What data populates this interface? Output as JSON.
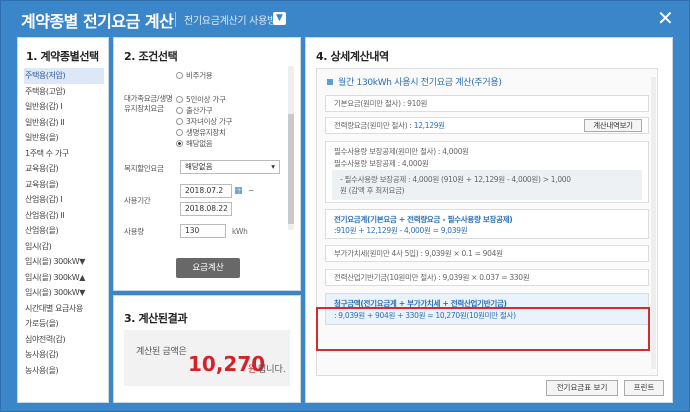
{
  "titlebar": {
    "title": "계약종별 전기요금 계산",
    "howto": "전기요금계산기 사용방법"
  },
  "panel1": {
    "title": "1. 계약종별선택",
    "items": [
      "주택용(저압)",
      "주택용(고압)",
      "일반용(갑) I",
      "일반용(갑) II",
      "일반용(을)",
      "1주택 수 가구",
      "교육용(갑)",
      "교육용(을)",
      "산업용(갑) I",
      "산업용(갑) II",
      "산업용(을)",
      "임시(갑)",
      "임시(을) 300kW▼",
      "임시(을) 300kW▲",
      "임시(을) 300kW▼",
      "시간대별 요금사용",
      "가로등(을)",
      "심야전력(갑)",
      "농사용(갑)",
      "농사용(을)"
    ]
  },
  "panel2": {
    "title": "2. 조건선택",
    "top_radio": "비주거용",
    "discount_label": "대가족요금/생명유지장치요금",
    "discount_options": [
      "5인이상 가구",
      "출산가구",
      "3자녀이상 가구",
      "생명유지장치",
      "해당없음"
    ],
    "welfare_label": "복지할인요금",
    "welfare_value": "해당없음",
    "period_label": "사용기간",
    "date_from": "2018.07.2",
    "date_to": "2018.08.22",
    "usage_label": "사용량",
    "usage_value": "130",
    "usage_unit": "kWh",
    "calc_button": "요금계산"
  },
  "panel3": {
    "title": "3. 계산된결과",
    "label": "계산된 금액은",
    "value": "10,270",
    "won": "원",
    "unit": "입니다."
  },
  "panel4": {
    "title": "4. 상세계산내역",
    "head": "월간 130kWh 사용시 전기요금 계산(주거용)",
    "base_fee": "기본요금(원미만 절사) : 910원",
    "energy_fee_label": "전력량요금(원미만 절사) : ",
    "energy_fee_value": "12,129원",
    "detail_btn": "계산내역보기",
    "guarantee1": "필수사용량 보장공제(원미만 절사) : 4,000원",
    "guarantee2": "필수사용량 보장공제 : 4,000원",
    "guarantee_note1": "- 필수사용량 보장공제 : 4,000원 (910원 + 12,129원 - 4,000원) > 1,000",
    "guarantee_note2": "원 (감액 후 최저요금)",
    "total_head": "전기요금계(기본요금 + 전력량요금 - 필수사용량 보장공제)",
    "total_value": ":910원 + 12,129원 - 4,000원 = 9,039원",
    "vat": "부가가치세(원미만 4사 5입) : 9,039원 × 0.1 = 904원",
    "fund": "전력산업기반기금(10원미만 절사) : 9,039원 × 0.037 = 330원",
    "charge_head": "청구금액(전기요금계 + 부가가치세 + 전력산업기반기금)",
    "charge_value": ": 9,039원 + 904원 + 330원 = 10,270원(10원미만 절사)",
    "table_btn": "전기요금표 보기",
    "print_btn": "프린트"
  }
}
